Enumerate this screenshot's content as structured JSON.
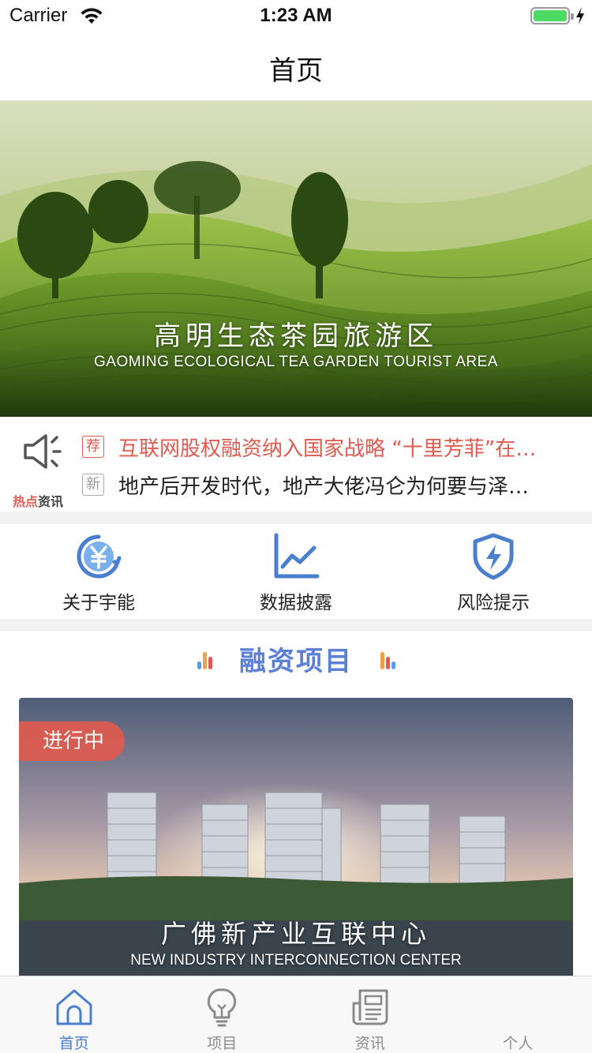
{
  "status_bar": {
    "carrier": "Carrier",
    "time": "1:23 AM",
    "battery_level": 1.0
  },
  "nav": {
    "title": "首页"
  },
  "banner": {
    "title_cn": "高明生态茶园旅游区",
    "title_en": "GAOMING ECOLOGICAL TEA GARDEN TOURIST AREA",
    "page_count": 3,
    "active_page": 0
  },
  "news": {
    "icon_label_hot": "热点",
    "icon_label_rest": "资讯",
    "items": [
      {
        "tag": "荐",
        "text": "互联网股权融资纳入国家战略 “十里芳菲”在…"
      },
      {
        "tag": "新",
        "text": "地产后开发时代，地产大佬冯仑为何要与泽…"
      }
    ]
  },
  "quick": [
    {
      "label": "关于宇能",
      "icon": "yuan-refresh-icon"
    },
    {
      "label": "数据披露",
      "icon": "line-chart-icon"
    },
    {
      "label": "风险提示",
      "icon": "shield-lightning-icon"
    }
  ],
  "projects": {
    "title": "融资项目",
    "card": {
      "status": "进行中",
      "name_cn": "广佛新产业互联中心",
      "name_en": "NEW INDUSTRY INTERCONNECTION CENTER"
    }
  },
  "tabs": [
    {
      "label": "首页",
      "icon": "home-icon",
      "active": true
    },
    {
      "label": "项目",
      "icon": "lightbulb-icon",
      "active": false
    },
    {
      "label": "资讯",
      "icon": "newspaper-icon",
      "active": false
    },
    {
      "label": "个人",
      "icon": "person-icon",
      "active": false
    }
  ],
  "colors": {
    "accent_blue": "#4a7fd0",
    "section_title": "#5b7fd6",
    "hot_red": "#e05a4f",
    "battery_green": "#4cd964"
  }
}
